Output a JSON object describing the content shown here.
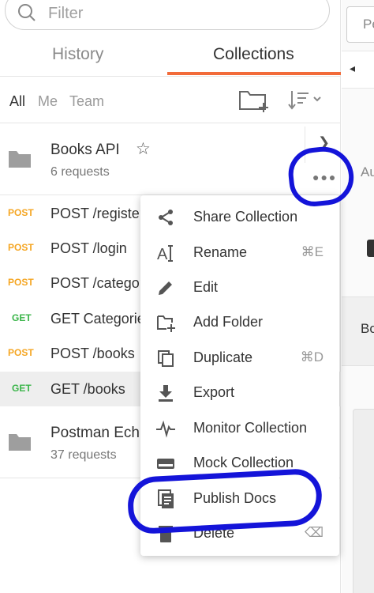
{
  "search": {
    "placeholder": "Filter"
  },
  "tabs": {
    "history": "History",
    "collections": "Collections"
  },
  "filters": {
    "all": "All",
    "me": "Me",
    "team": "Team"
  },
  "collections": [
    {
      "name": "Books API",
      "count": "6 requests"
    },
    {
      "name": "Postman Ech",
      "count": "37 requests"
    }
  ],
  "requests": [
    {
      "method": "POST",
      "path": "POST /register"
    },
    {
      "method": "POST",
      "path": "POST /login"
    },
    {
      "method": "POST",
      "path": "POST /categor"
    },
    {
      "method": "GET",
      "path": "GET Categorie"
    },
    {
      "method": "POST",
      "path": "POST /books"
    },
    {
      "method": "GET",
      "path": "GET /books"
    }
  ],
  "menu": [
    {
      "label": "Share Collection",
      "shortcut": "",
      "icon": "share-icon"
    },
    {
      "label": "Rename",
      "shortcut": "⌘E",
      "icon": "rename-icon"
    },
    {
      "label": "Edit",
      "shortcut": "",
      "icon": "edit-icon"
    },
    {
      "label": "Add Folder",
      "shortcut": "",
      "icon": "add-folder-icon"
    },
    {
      "label": "Duplicate",
      "shortcut": "⌘D",
      "icon": "duplicate-icon"
    },
    {
      "label": "Export",
      "shortcut": "",
      "icon": "export-icon"
    },
    {
      "label": "Monitor Collection",
      "shortcut": "",
      "icon": "monitor-icon"
    },
    {
      "label": "Mock Collection",
      "shortcut": "",
      "icon": "mock-icon"
    },
    {
      "label": "Publish Docs",
      "shortcut": "",
      "icon": "publish-docs-icon"
    },
    {
      "label": "Delete",
      "shortcut": "⌫",
      "icon": "delete-icon"
    }
  ],
  "right_pane": {
    "input_text": "Pe",
    "au_text": "Au",
    "bo_text": "Bo"
  },
  "colors": {
    "accent": "#f26b3a",
    "post": "#f5a623",
    "get": "#3bb54a",
    "annotation": "#1414d9"
  }
}
